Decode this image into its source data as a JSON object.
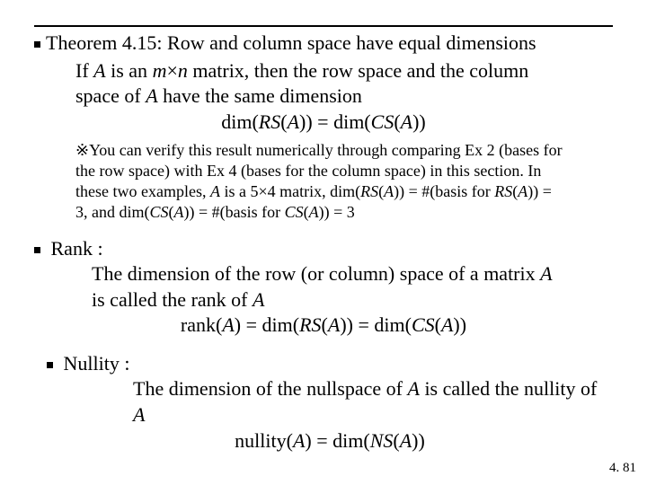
{
  "theorem": {
    "title": "Theorem 4.15: Row and column space have equal dimensions",
    "line1_pre": "If ",
    "line1_A": "A",
    "line1_mid": " is an ",
    "line1_m": "m",
    "line1_cross": "×",
    "line1_n": "n",
    "line1_post": " matrix, then the row space and the column",
    "line2_pre": "space of ",
    "line2_A": "A",
    "line2_post": " have the same dimension",
    "eqn_pre": "dim(",
    "eqn_RS": "RS",
    "eqn_mid": "(",
    "eqn_A": "A",
    "eqn_post": ")) = dim(",
    "eqn_CS": "CS",
    "eqn_tail": "(",
    "eqn_A2": "A",
    "eqn_end": "))"
  },
  "note": {
    "mark": "※",
    "l1": "You can verify this result numerically through comparing Ex 2 (bases for",
    "l2": "the row space) with Ex 4 (bases for the column space) in this section. In",
    "l3a": "these two examples, ",
    "l3_A": "A",
    "l3b": " is a 5×4 matrix, dim(",
    "l3_RS": "RS",
    "l3c": "(",
    "l3_A2": "A",
    "l3d": ")) = #(basis for ",
    "l3_RS2": "RS",
    "l3e": "(",
    "l3_A3": "A",
    "l3f": ")) =",
    "l4a": "3, and dim(",
    "l4_CS": "CS",
    "l4b": "(",
    "l4_A": "A",
    "l4c": ")) = #(basis for ",
    "l4_CS2": "CS",
    "l4d": "(",
    "l4_A2": "A",
    "l4e": ")) = 3"
  },
  "rank": {
    "heading": "Rank :",
    "l1a": "The dimension of the row (or column) space of a matrix ",
    "l1_A": "A",
    "l2a": "is called the rank of ",
    "l2_A": "A",
    "eqa": "rank(",
    "eq_A": "A",
    "eqb": ") = dim(",
    "eq_RS": "RS",
    "eqc": "(",
    "eq_A2": "A",
    "eqd": ")) = dim(",
    "eq_CS": "CS",
    "eqe": "(",
    "eq_A3": "A",
    "eqf": "))"
  },
  "nullity": {
    "heading": "Nullity :",
    "l1a": "The dimension of the nullspace of ",
    "l1_A": "A",
    "l1b": " is called the nullity of ",
    "l1_A2": "A",
    "eqa": "nullity(",
    "eq_A": "A",
    "eqb": ") = dim(",
    "eq_NS": "NS",
    "eqc": "(",
    "eq_A2": "A",
    "eqd": "))"
  },
  "page": "4. 81"
}
